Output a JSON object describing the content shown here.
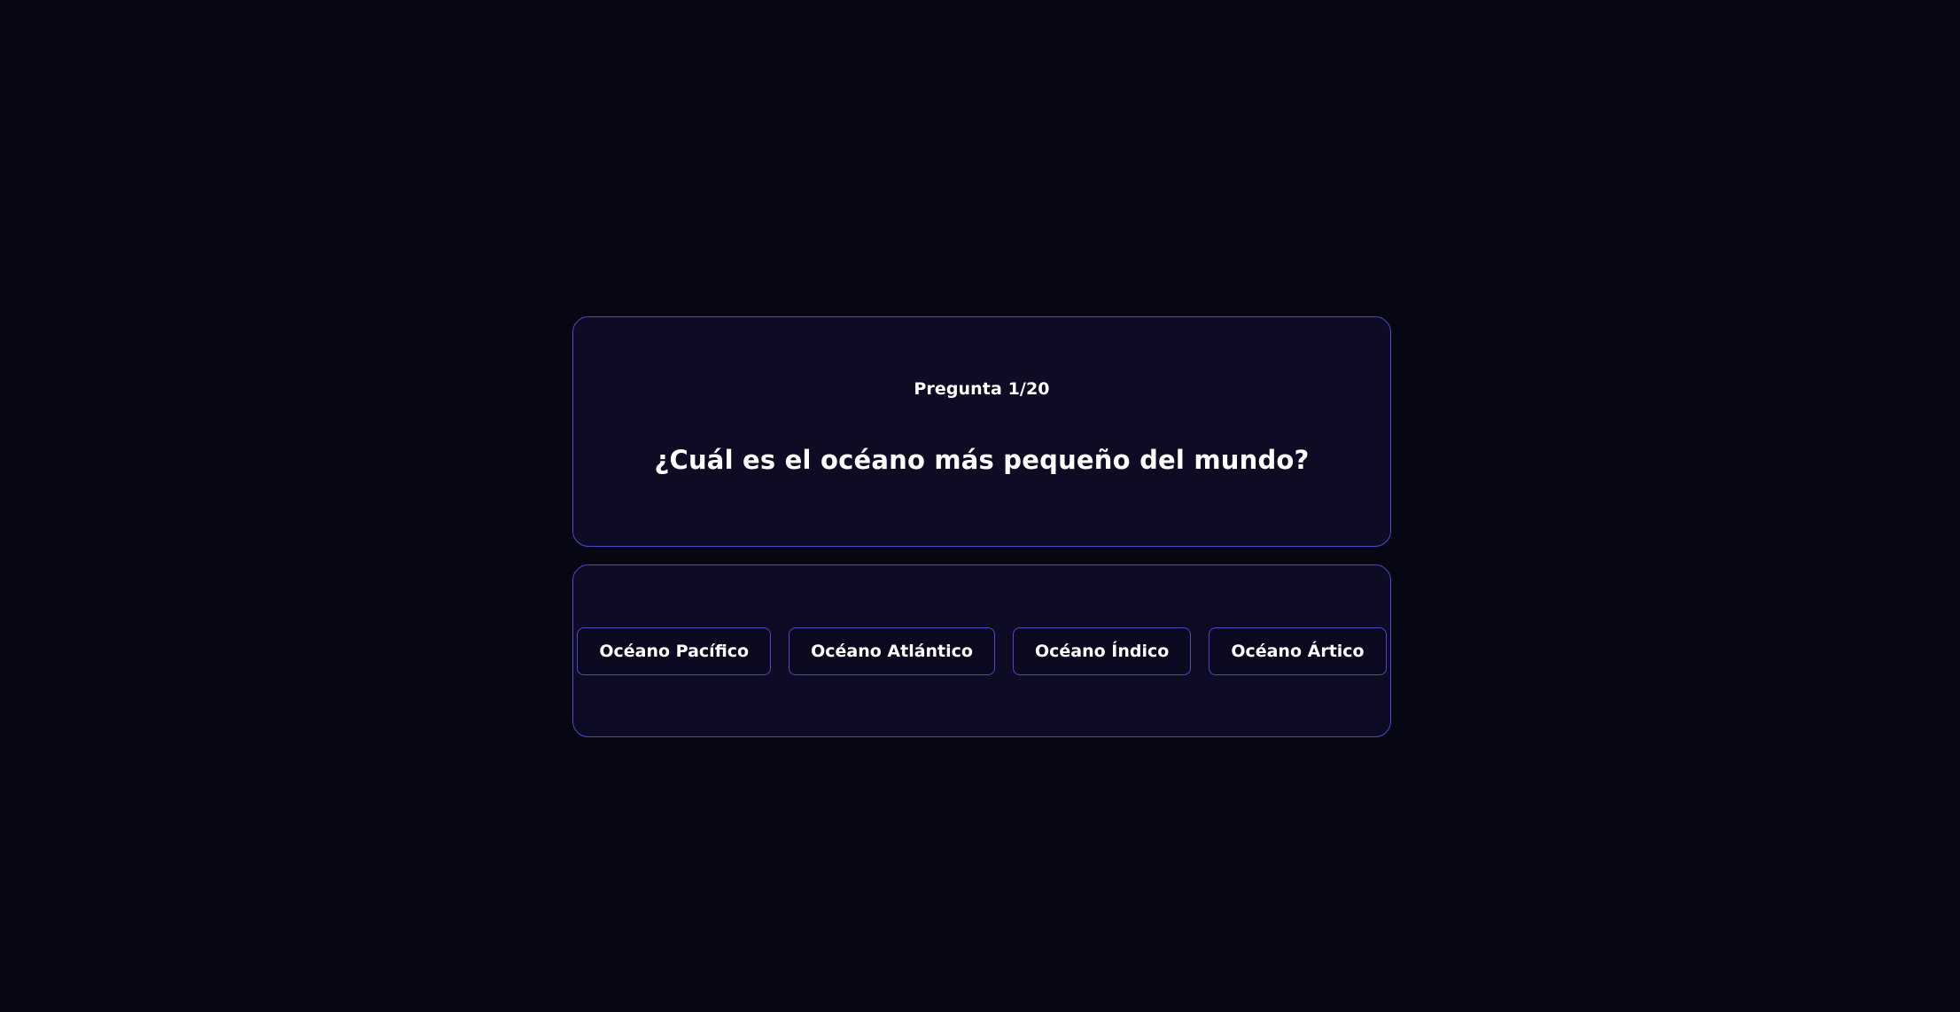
{
  "quiz": {
    "counter": "Pregunta 1/20",
    "question": "¿Cuál es el océano más pequeño del mundo?",
    "answers": [
      "Océano Pacífico",
      "Océano Atlántico",
      "Océano Índico",
      "Océano Ártico"
    ]
  },
  "colors": {
    "background": "#060713",
    "card": "#0e0c24",
    "accent_border": "#5147c7",
    "text": "#ffffff"
  }
}
